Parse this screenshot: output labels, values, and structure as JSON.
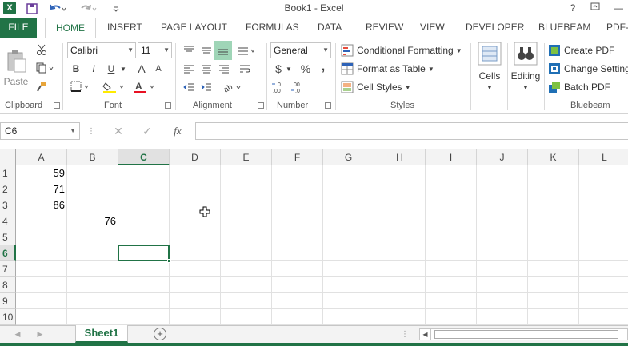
{
  "window": {
    "title": "Book1 - Excel"
  },
  "quick_access": {
    "save_icon": "save-icon",
    "undo_icon": "undo-icon",
    "redo_icon": "redo-icon"
  },
  "window_controls": {
    "help": "?",
    "restore": "⧉",
    "minimize": "—"
  },
  "tabs": [
    "FILE",
    "HOME",
    "INSERT",
    "PAGE LAYOUT",
    "FORMULAS",
    "DATA",
    "REVIEW",
    "VIEW",
    "DEVELOPER",
    "BLUEBEAM",
    "PDF-"
  ],
  "ribbon": {
    "clipboard": {
      "paste": "Paste",
      "label": "Clipboard"
    },
    "font": {
      "name": "Calibri",
      "size": "11",
      "bold": "B",
      "italic": "I",
      "underline": "U",
      "grow": "A",
      "shrink": "A",
      "label": "Font"
    },
    "alignment": {
      "label": "Alignment"
    },
    "number": {
      "format": "General",
      "currency": "$",
      "percent": "%",
      "comma": ",",
      "inc_decimal": "←.0\n.00",
      "dec_decimal": ".00\n→.0",
      "label": "Number"
    },
    "styles": {
      "conditional": "Conditional Formatting",
      "table": "Format as Table",
      "cell_styles": "Cell Styles",
      "label": "Styles"
    },
    "cells": {
      "label": "Cells"
    },
    "editing": {
      "label": "Editing"
    },
    "bluebeam": {
      "create": "Create PDF",
      "change": "Change Settings",
      "batch": "Batch PDF",
      "label": "Bluebeam"
    }
  },
  "formula_bar": {
    "name_box": "C6",
    "cancel": "✕",
    "enter": "✓",
    "fx": "fx",
    "content": ""
  },
  "grid": {
    "columns": [
      "A",
      "B",
      "C",
      "D",
      "E",
      "F",
      "G",
      "H",
      "I",
      "J",
      "K",
      "L"
    ],
    "rows": [
      "1",
      "2",
      "3",
      "4",
      "5",
      "6",
      "7",
      "8",
      "9",
      "10"
    ],
    "selected_column": "C",
    "selected_row": "6",
    "cells": {
      "A1": "59",
      "A2": "71",
      "A3": "86",
      "B4": "76"
    }
  },
  "sheets": {
    "active": "Sheet1",
    "add": "+"
  }
}
